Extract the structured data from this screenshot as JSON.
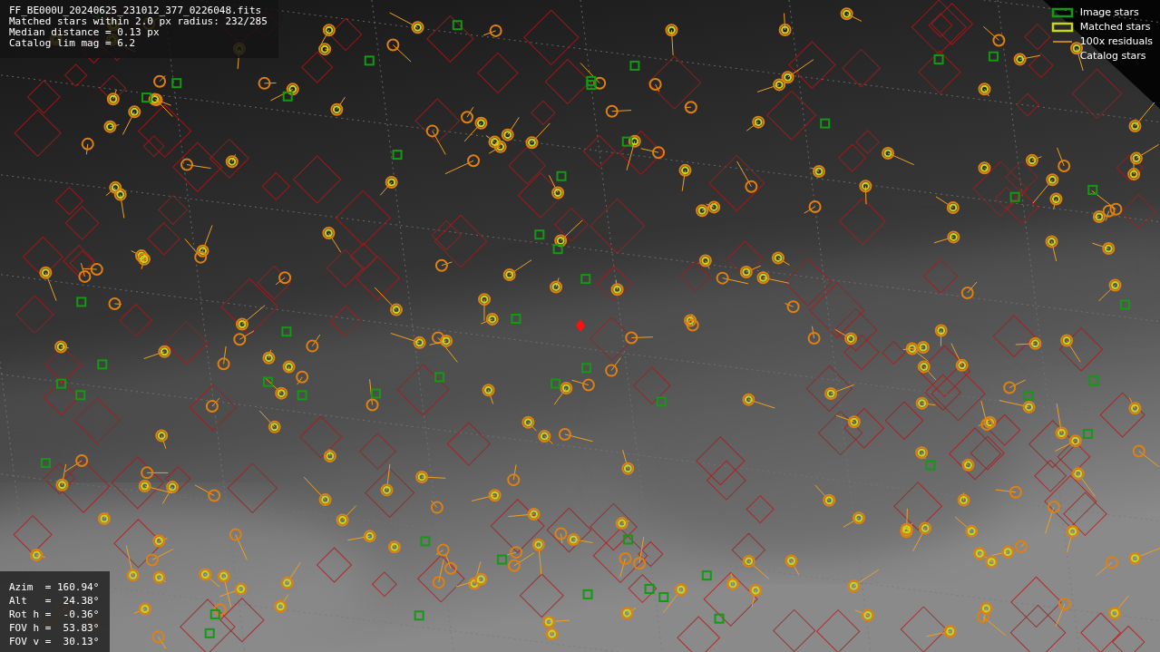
{
  "info_panel": {
    "lines": [
      "FF_BE000U_20240625_231012_377_0226048.fits",
      "Matched stars within 2.0 px radius: 232/285",
      "Median distance = 0.13 px",
      "Catalog lim mag = 6.2"
    ]
  },
  "legend": [
    {
      "label": "Image stars"
    },
    {
      "kind": "matched",
      "label": "Matched stars"
    },
    {
      "kind": "residual",
      "label": "100x residuals"
    },
    {
      "kind": "catalog",
      "label": "Catalog stars"
    }
  ],
  "pointing_panel": {
    "lines": [
      "Azim  = 160.94°",
      "Alt   =  24.38°",
      "Rot h =  -0.36°",
      "FOV h =  53.83°",
      "FOV v =  30.13°"
    ]
  }
}
